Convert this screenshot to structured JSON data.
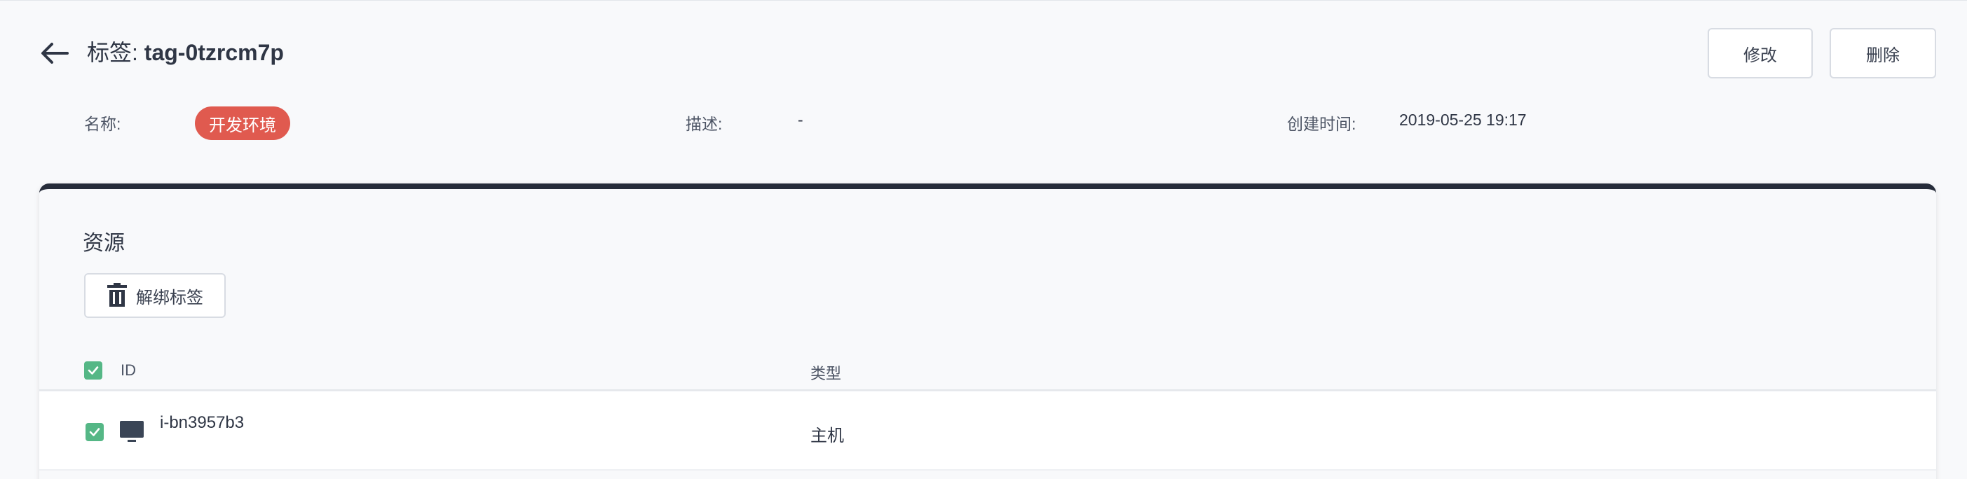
{
  "header": {
    "title_prefix": "标签: ",
    "title_name": "tag-0tzrcm7p",
    "edit_label": "修改",
    "delete_label": "删除"
  },
  "info": {
    "name_label": "名称:",
    "name_value": "开发环境",
    "desc_label": "描述:",
    "desc_value": "-",
    "created_label": "创建时间:",
    "created_value": "2019-05-25 19:17"
  },
  "resources": {
    "title": "资源",
    "unbind_label": "解绑标签",
    "columns": [
      "ID",
      "类型"
    ],
    "rows": [
      {
        "id": "i-bn3957b3",
        "type": "主机",
        "icon": "monitor-icon",
        "checked": true
      }
    ],
    "select_all_checked": true
  },
  "colors": {
    "tag_pill": "#e05a4f",
    "checkbox": "#55b786",
    "card_top_border": "#262c3a"
  },
  "icons": {
    "back": "arrow-left-icon",
    "unbind": "trash-icon",
    "row_type": "monitor-icon",
    "check": "check-icon"
  }
}
